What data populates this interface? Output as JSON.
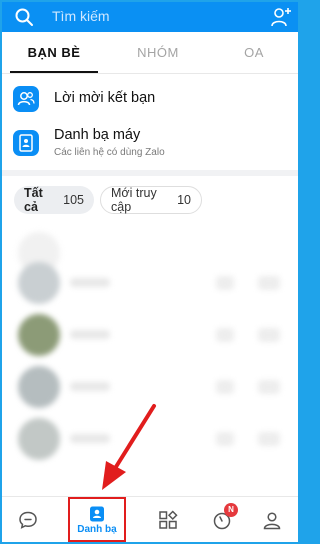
{
  "header": {
    "search_placeholder": "Tìm kiếm",
    "search_icon": "search-icon",
    "add_friend_icon": "add-friend-icon"
  },
  "tabs": [
    {
      "label": "BẠN BÈ",
      "active": true
    },
    {
      "label": "NHÓM",
      "active": false
    },
    {
      "label": "OA",
      "active": false
    }
  ],
  "menu": {
    "friend_requests": {
      "title": "Lời mời kết bạn",
      "icon": "friends-icon"
    },
    "phonebook": {
      "title": "Danh bạ máy",
      "subtitle": "Các liên hệ có dùng Zalo",
      "icon": "contact-book-icon"
    }
  },
  "filters": [
    {
      "label": "Tất cả",
      "count": "105",
      "selected": true
    },
    {
      "label": "Mới truy cập",
      "count": "10",
      "selected": false
    }
  ],
  "bottom_nav": {
    "messages_icon": "chat-bubble-icon",
    "contacts_label": "Danh bạ",
    "discover_icon": "grid-icon",
    "timeline_icon": "clock-icon",
    "timeline_badge": "N",
    "profile_icon": "person-icon"
  },
  "colors": {
    "brand": "#0a90f3",
    "highlight": "#e11d1d",
    "badge": "#e5393d"
  }
}
